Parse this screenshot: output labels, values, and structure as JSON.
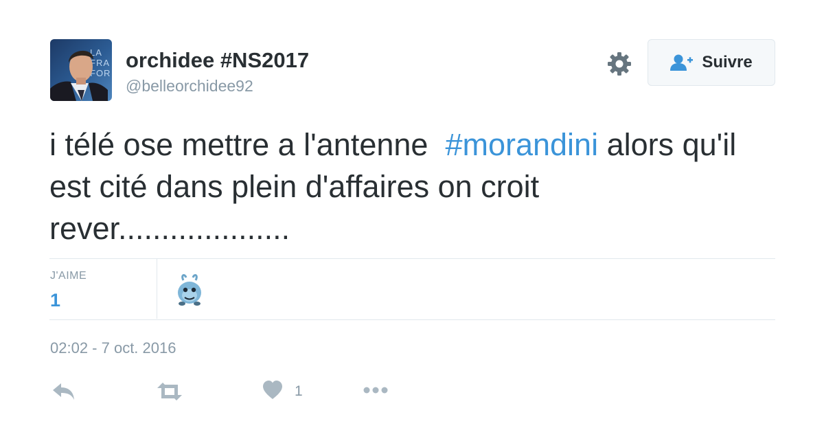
{
  "user": {
    "name": "orchidee #NS2017",
    "handle": "@belleorchidee92",
    "avatar_text": "LA\nFRA\nFOR"
  },
  "header": {
    "settings_icon": "gear-icon",
    "follow_label": "Suivre",
    "follow_icon": "add-user-icon"
  },
  "tweet": {
    "text_before": "i télé ose mettre a l'antenne  ",
    "hashtag": "#morandini",
    "text_after": " alors qu'il est cité dans plein d'affaires on croit rever...................."
  },
  "stats": {
    "likes_label": "J'AIME",
    "likes_count": "1"
  },
  "meta": {
    "timestamp": "02:02 - 7 oct. 2016"
  },
  "actions": {
    "reply_icon": "reply-icon",
    "retweet_icon": "retweet-icon",
    "like_icon": "heart-icon",
    "like_count": "1",
    "more_icon": "more-icon"
  },
  "colors": {
    "text": "#292f33",
    "muted": "#8899a6",
    "link": "#3b94d9",
    "border": "#e1e8ed",
    "button_bg": "#f5f8fa",
    "icon": "#66757f",
    "icon_light": "#aab8c2"
  }
}
